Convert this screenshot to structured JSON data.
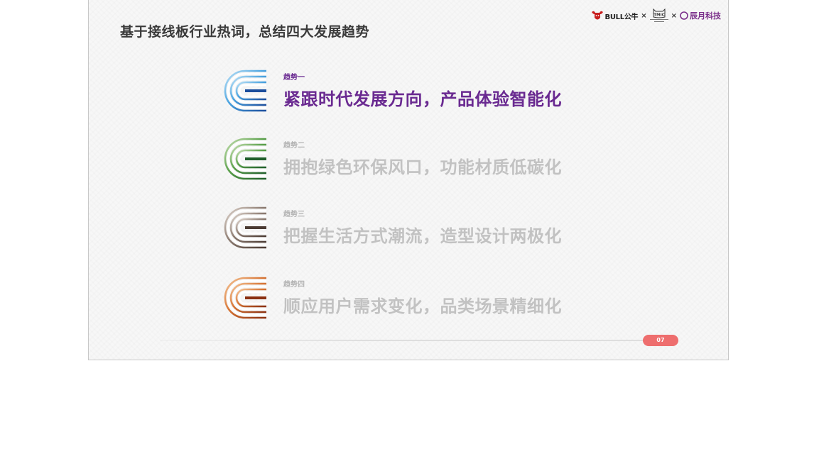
{
  "slide": {
    "title": "基于接线板行业热词，总结四大发展趋势",
    "page_number": "07"
  },
  "brands": {
    "bull_text": "BULL公牛",
    "separator": "×",
    "tmic_text": "TMIC",
    "chenyue_text": "辰月科技"
  },
  "trends": [
    {
      "label": "趋势一",
      "text": "紧跟时代发展方向，产品体验智能化",
      "state": "active",
      "icon": "blue-stripes-icon",
      "colors": [
        "#1b4d9c",
        "#4aa3e0",
        "#bfe3f7"
      ]
    },
    {
      "label": "趋势二",
      "text": "拥抱绿色环保风口，功能材质低碳化",
      "state": "muted",
      "icon": "green-stripes-icon",
      "colors": [
        "#1f5e2a",
        "#5aa04a",
        "#c9e2b4"
      ]
    },
    {
      "label": "趋势三",
      "text": "把握生活方式潮流，造型设计两极化",
      "state": "muted",
      "icon": "brown-stripes-icon",
      "colors": [
        "#4a3a32",
        "#8d7c72",
        "#e2d8d0"
      ]
    },
    {
      "label": "趋势四",
      "text": "顺应用户需求变化，品类场景精细化",
      "state": "muted",
      "icon": "orange-stripes-icon",
      "colors": [
        "#8a2f10",
        "#d77535",
        "#f6c79a"
      ]
    }
  ]
}
